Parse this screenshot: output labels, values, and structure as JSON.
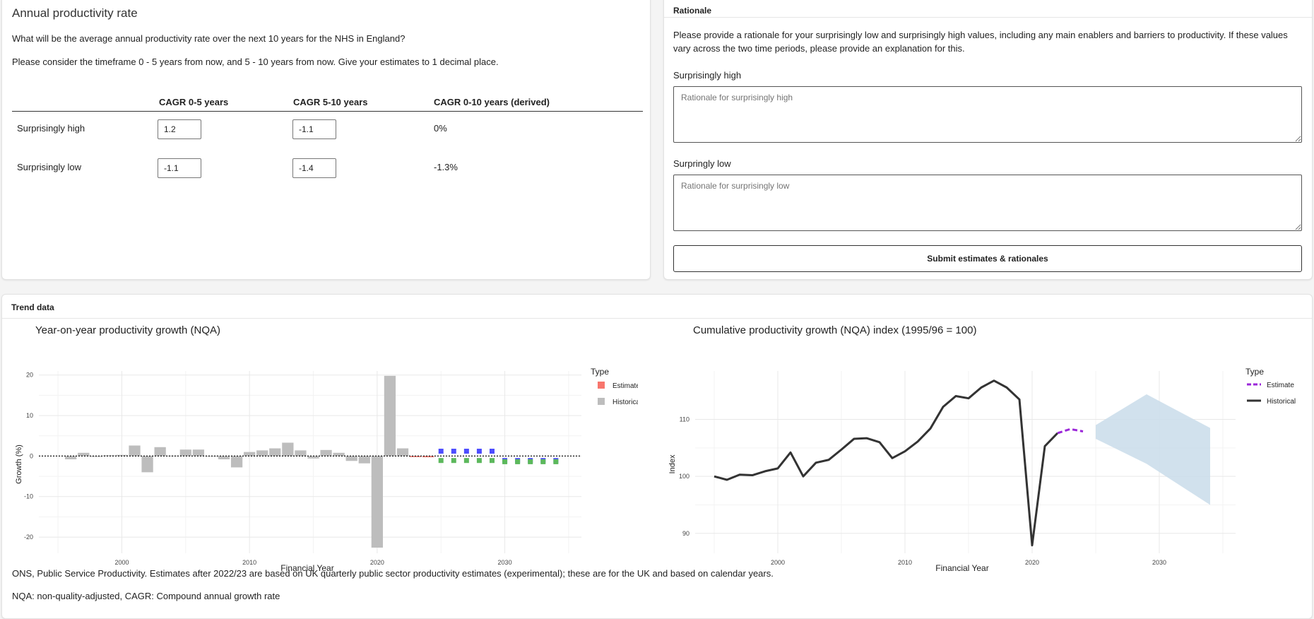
{
  "annual": {
    "title": "Annual productivity rate",
    "question": "What will be the average annual productivity rate over the next 10 years for the NHS in England?",
    "instruction": "Please consider the timeframe 0 - 5 years from now, and 5 - 10 years from now. Give your estimates to 1 decimal place.",
    "columns": [
      "CAGR 0-5 years",
      "CAGR 5-10 years",
      "CAGR 0-10 years (derived)"
    ],
    "rows": [
      {
        "label": "Surprisingly high",
        "cagr_0_5": "1.2",
        "cagr_5_10": "-1.1",
        "derived": "0%"
      },
      {
        "label": "Surprisingly low",
        "cagr_0_5": "-1.1",
        "cagr_5_10": "-1.4",
        "derived": "-1.3%"
      }
    ]
  },
  "rationale": {
    "header": "Rationale",
    "text": "Please provide a rationale for your surprisingly low and surprisingly high values, including any main enablers and barriers to productivity. If these values vary across the two time periods, please provide an explanation for this.",
    "high_label": "Surprisingly high",
    "high_placeholder": "Rationale for surprisingly high",
    "low_label": "Surpringly low",
    "low_placeholder": "Rationale for surprisingly low",
    "submit_label": "Submit estimates & rationales"
  },
  "trend": {
    "header": "Trend data",
    "footnote_source": "ONS, Public Service Productivity. Estimates after 2022/23 are based on UK quarterly public sector productivity estimates (experimental); these are for the UK and based on calendar years.",
    "footnote_abbrev": "NQA: non-quality-adjusted, CAGR: Compound annual growth rate"
  },
  "colors": {
    "historical_bar": "#bdbdbd",
    "estimate": "#f8766d",
    "high_estimate": "#4d4dff",
    "low_estimate": "#5cb85c",
    "cumulative_line": "#333333",
    "cumulative_estimate": "#9b27d9",
    "range_band": "#c9dcea"
  },
  "chart_data": [
    {
      "type": "bar",
      "title": "Year-on-year productivity growth (NQA)",
      "xlabel": "Financial Year",
      "ylabel": "Growth (%)",
      "xlim": [
        1993.5,
        2036
      ],
      "ylim": [
        -24,
        21
      ],
      "xticks": [
        2000,
        2010,
        2020,
        2030
      ],
      "yticks": [
        20,
        10,
        0,
        -10,
        -20
      ],
      "grid": true,
      "reference_line": 0,
      "legend": {
        "title": "Type",
        "entries": [
          "Estimate",
          "Historical"
        ],
        "placement": "right"
      },
      "series": [
        {
          "name": "Historical",
          "x": [
            1996,
            1997,
            1998,
            1999,
            2000,
            2001,
            2002,
            2003,
            2004,
            2005,
            2006,
            2007,
            2008,
            2009,
            2010,
            2011,
            2012,
            2013,
            2014,
            2015,
            2016,
            2017,
            2018,
            2019,
            2020,
            2021,
            2022
          ],
          "values": [
            -0.8,
            0.8,
            -0.2,
            0.2,
            0.3,
            2.6,
            -4.0,
            2.2,
            0.1,
            1.6,
            1.6,
            0.0,
            -0.8,
            -2.8,
            1.0,
            1.4,
            1.9,
            3.3,
            1.4,
            -0.6,
            1.5,
            0.8,
            -1.2,
            -1.8,
            -22.6,
            19.8,
            1.9
          ]
        },
        {
          "name": "Estimate",
          "x": [
            2023,
            2024
          ],
          "values": [
            -0.2,
            -0.3
          ]
        }
      ],
      "high_estimates": {
        "x": [
          2025,
          2026,
          2027,
          2028,
          2029,
          2030,
          2031,
          2032,
          2033,
          2034
        ],
        "values": [
          1.2,
          1.2,
          1.2,
          1.2,
          1.2,
          -1.1,
          -1.1,
          -1.1,
          -1.1,
          -1.1
        ]
      },
      "low_estimates": {
        "x": [
          2025,
          2026,
          2027,
          2028,
          2029,
          2030,
          2031,
          2032,
          2033,
          2034
        ],
        "values": [
          -1.1,
          -1.1,
          -1.1,
          -1.1,
          -1.1,
          -1.4,
          -1.4,
          -1.4,
          -1.4,
          -1.4
        ]
      }
    },
    {
      "type": "line",
      "title": "Cumulative productivity growth (NQA) index (1995/96 = 100)",
      "xlabel": "Financial Year",
      "ylabel": "Index",
      "xlim": [
        1993.5,
        2036
      ],
      "ylim": [
        86.5,
        118.5
      ],
      "xticks": [
        2000,
        2010,
        2020,
        2030
      ],
      "yticks": [
        110,
        100,
        90
      ],
      "grid": true,
      "legend": {
        "title": "Type",
        "entries": [
          "Estimate",
          "Historical"
        ],
        "placement": "right"
      },
      "series": [
        {
          "name": "Historical",
          "x": [
            1995,
            1996,
            1997,
            1998,
            1999,
            2000,
            2001,
            2002,
            2003,
            2004,
            2005,
            2006,
            2007,
            2008,
            2009,
            2010,
            2011,
            2012,
            2013,
            2014,
            2015,
            2016,
            2017,
            2018,
            2019,
            2020,
            2021,
            2022
          ],
          "values": [
            100.0,
            99.4,
            100.3,
            100.2,
            100.9,
            101.4,
            104.2,
            100.0,
            102.4,
            102.9,
            104.7,
            106.6,
            106.7,
            106.0,
            103.2,
            104.4,
            106.1,
            108.4,
            112.2,
            114.1,
            113.7,
            115.6,
            116.8,
            115.6,
            113.5,
            87.9,
            105.3,
            107.6
          ]
        },
        {
          "name": "Estimate",
          "x": [
            2022,
            2023,
            2024
          ],
          "values": [
            107.6,
            108.3,
            107.9
          ]
        }
      ],
      "range_band": {
        "x": [
          2025,
          2029,
          2034
        ],
        "upper": [
          109.0,
          114.4,
          108.5
        ],
        "lower": [
          106.6,
          102.2,
          95.0
        ]
      }
    }
  ]
}
